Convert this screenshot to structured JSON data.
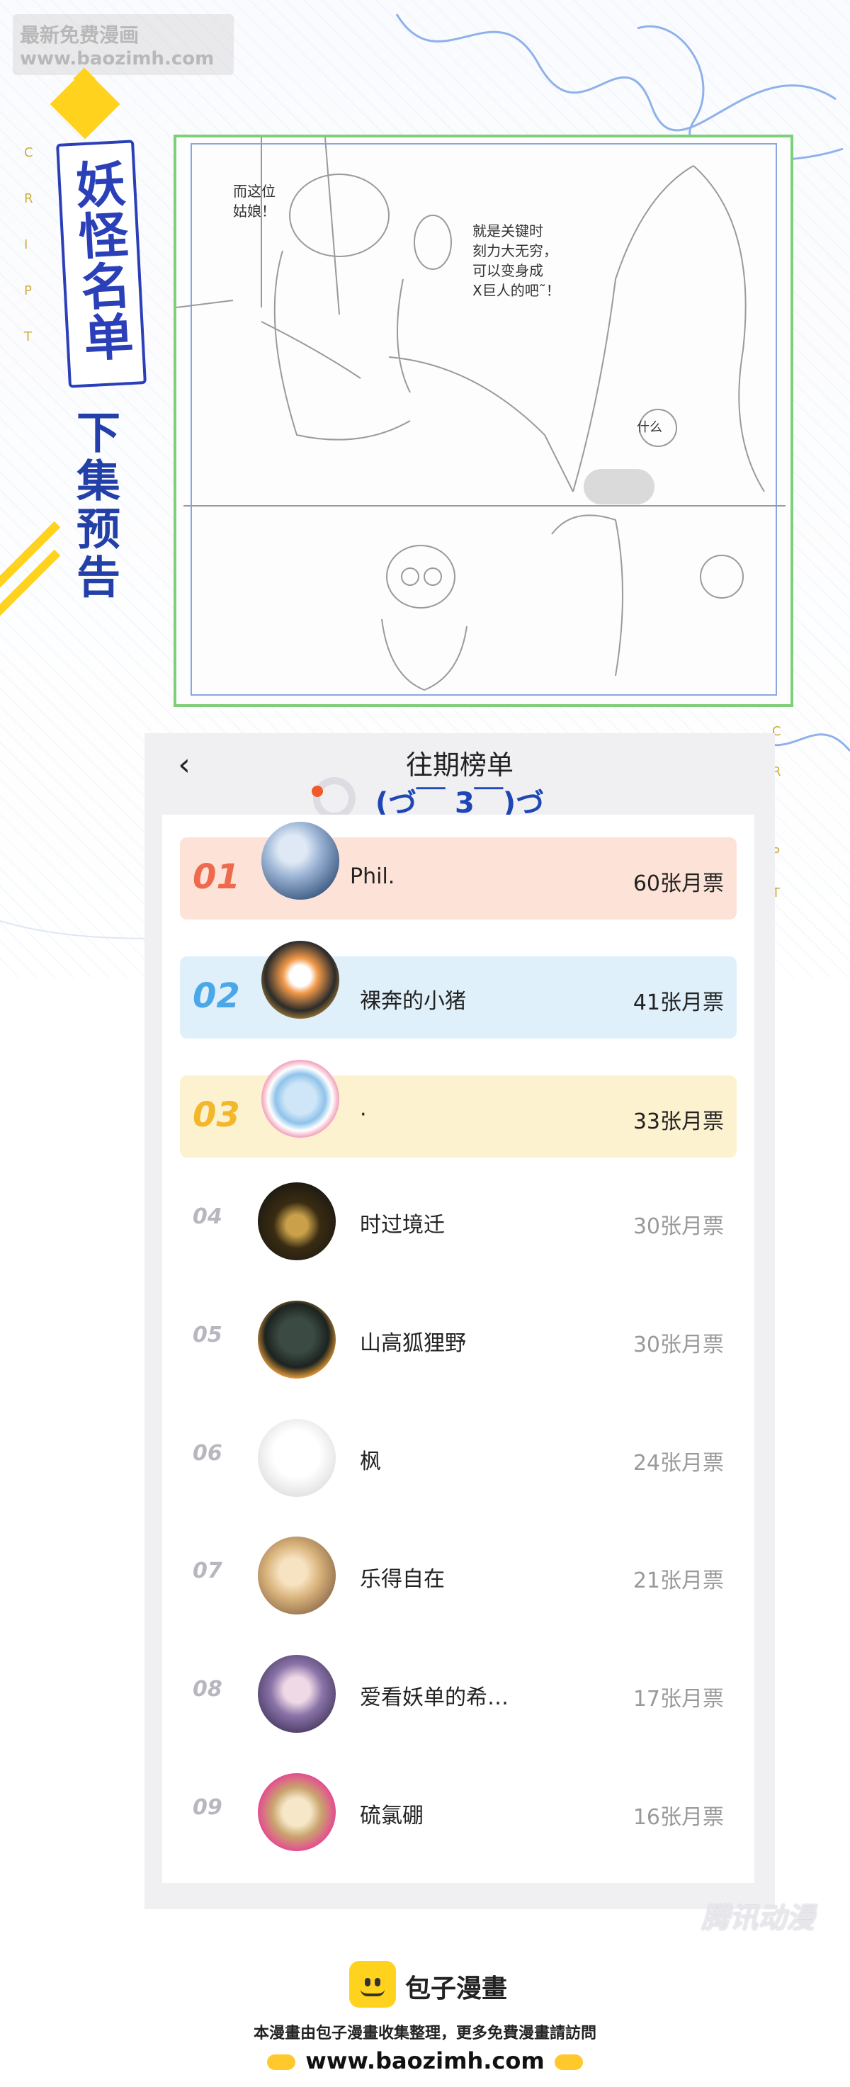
{
  "watermark": {
    "line1": "最新免费漫画",
    "line2": "www.baozimh.com"
  },
  "sidebar": {
    "logo": "妖怪名单",
    "preview_title": "下集预告",
    "letters": [
      "C",
      "R",
      "I",
      "P",
      "T"
    ]
  },
  "sketch": {
    "bubble1": "而这位\n姑娘！",
    "bubble2": "就是关键时\n刻力大无穷，\n可以变身成\nX巨人的吧˜！",
    "bubble3": "什么"
  },
  "ranking": {
    "title": "往期榜单",
    "emoticon": "(づ￣ 3￣)づ",
    "rows": [
      {
        "rank": "01",
        "name": "Phil.",
        "votes": "60张月票"
      },
      {
        "rank": "02",
        "name": "裸奔的小猪",
        "votes": "41张月票"
      },
      {
        "rank": "03",
        "name": "·",
        "votes": "33张月票"
      },
      {
        "rank": "04",
        "name": "时过境迁",
        "votes": "30张月票"
      },
      {
        "rank": "05",
        "name": "山高狐狸野",
        "votes": "30张月票"
      },
      {
        "rank": "06",
        "name": "枫",
        "votes": "24张月票"
      },
      {
        "rank": "07",
        "name": "乐得自在",
        "votes": "21张月票"
      },
      {
        "rank": "08",
        "name": "爱看妖单的希…",
        "votes": "17张月票"
      },
      {
        "rank": "09",
        "name": "硫氯硼",
        "votes": "16张月票"
      }
    ]
  },
  "corner_logo": "腾讯动漫",
  "footer": {
    "brand": "包子漫畫",
    "note": "本漫畫由包子漫畫收集整理，更多免費漫畫請訪問",
    "url": "www.baozimh.com"
  },
  "colors": {
    "accent_yellow": "#ffd21e",
    "title_blue": "#2340a8",
    "rank1": "#ee6a4c",
    "rank2": "#4ba8e8",
    "rank3": "#f4b62a"
  }
}
